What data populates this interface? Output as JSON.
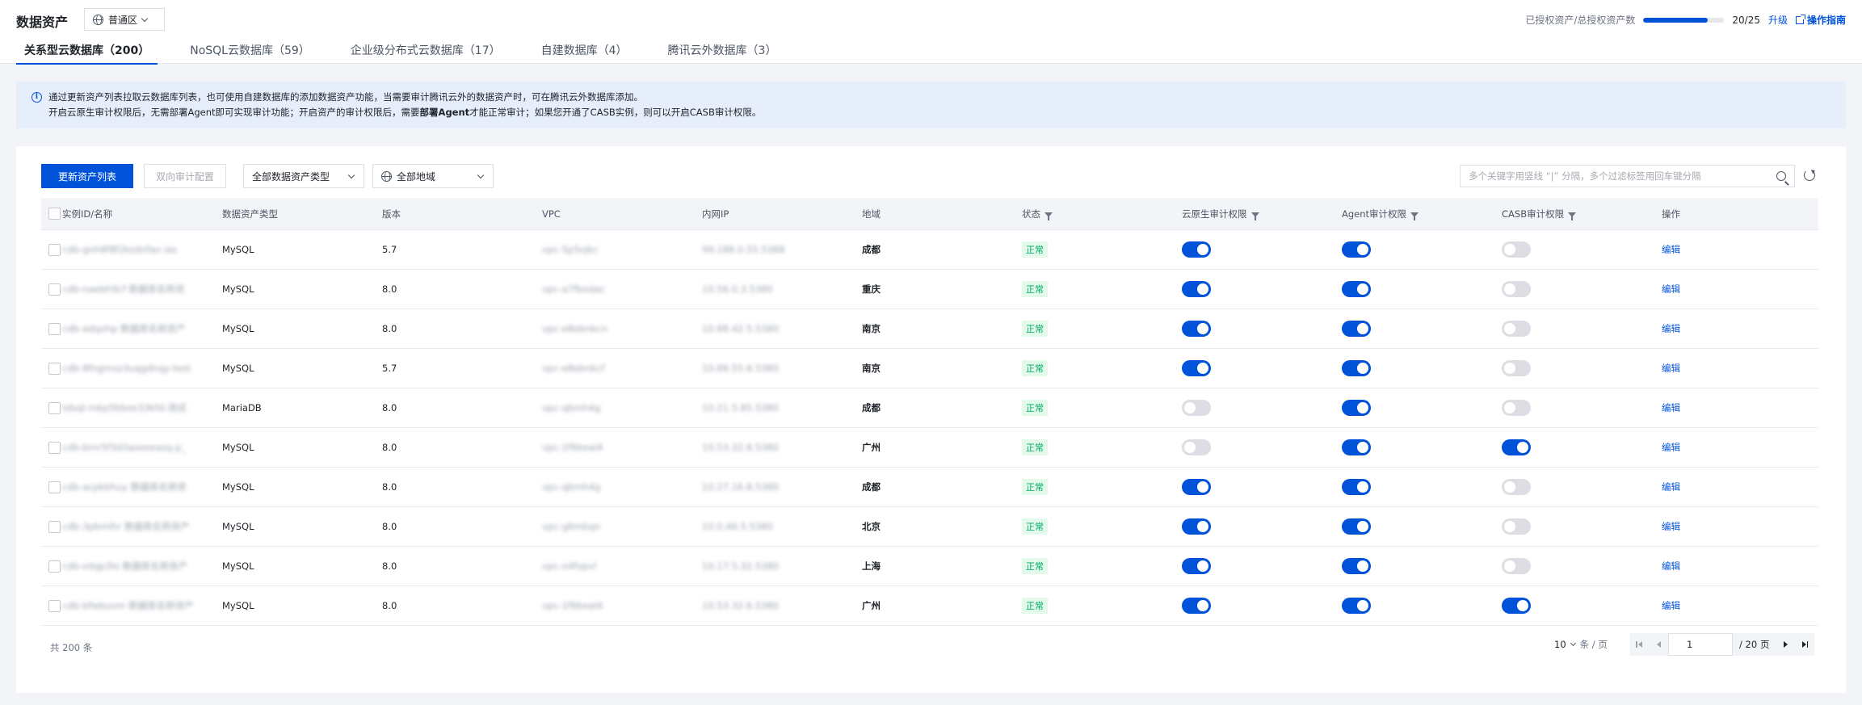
{
  "header": {
    "title": "数据资产",
    "region": "普通区",
    "quota_label": "已授权资产/总授权资产数",
    "quota_used": 20,
    "quota_total": 25,
    "quota_text": "20/25",
    "upgrade": "升级",
    "guide": "操作指南"
  },
  "tabs": [
    {
      "label": "关系型云数据库（200）",
      "active": true
    },
    {
      "label": "NoSQL云数据库（59）",
      "active": false
    },
    {
      "label": "企业级分布式云数据库（17）",
      "active": false
    },
    {
      "label": "自建数据库（4）",
      "active": false
    },
    {
      "label": "腾讯云外数据库（3）",
      "active": false
    }
  ],
  "notice": {
    "line1": "通过更新资产列表拉取云数据库列表，也可使用自建数据库的添加数据资产功能，当需要审计腾讯云外的数据资产时，可在腾讯云外数据库添加。",
    "line2_a": "开启云原生审计权限后，无需部署Agent即可实现审计功能；开启资产的审计权限后，需要",
    "line2_b": "部署Agent",
    "line2_c": "才能正常审计；如果您开通了CASB实例，则可以开启CASB审计权限。"
  },
  "toolbar": {
    "update_button": "更新资产列表",
    "bidirectional_button": "双向审计配置",
    "asset_type_select": "全部数据资产类型",
    "region_select": "全部地域",
    "search_placeholder": "多个关键字用竖线 “|” 分隔，多个过滤标签用回车键分隔"
  },
  "table": {
    "headers": [
      "实例ID/名称",
      "数据资产类型",
      "版本",
      "VPC",
      "内网IP",
      "地域",
      "状态",
      "云原生审计权限",
      "Agent审计权限",
      "CASB审计权限",
      "操作"
    ],
    "rows": [
      {
        "id": "cdb-gnh8f8f2ksdnfao ias",
        "type": "MySQL",
        "version": "5.7",
        "vpc": "vpc-5p5ojkc",
        "ip": "99.188.0.55.5388",
        "region": "成都",
        "status": "正常",
        "cloud": true,
        "agent": true,
        "casb": false,
        "action": "编辑"
      },
      {
        "id": "cdb-naebh9cf 数据库名称资",
        "type": "MySQL",
        "version": "8.0",
        "vpc": "vpc-a7fbodac",
        "ip": "10.56.0.3.5380",
        "region": "重庆",
        "status": "正常",
        "cloud": true,
        "agent": true,
        "casb": false,
        "action": "编辑"
      },
      {
        "id": "cdb-adqohp 数据库名称资产",
        "type": "MySQL",
        "version": "8.0",
        "vpc": "vpc-e8ebnkcn",
        "ip": "10.88.42.5.5380",
        "region": "南京",
        "status": "正常",
        "cloud": true,
        "agent": true,
        "casb": false,
        "action": "编辑"
      },
      {
        "id": "cdb-8fngmoz3uqgdnqy-test",
        "type": "MySQL",
        "version": "5.7",
        "vpc": "vpc-e8ebnkcf",
        "ip": "10.88.55.8.5380",
        "region": "南京",
        "status": "正常",
        "cloud": true,
        "agent": true,
        "casb": false,
        "action": "编辑"
      },
      {
        "id": "tdsql-mkp5bboe33kfd-测试",
        "type": "MariaDB",
        "version": "8.0",
        "vpc": "vpc-qbmh4g",
        "ip": "10.21.5.85.5380",
        "region": "成都",
        "status": "正常",
        "cloud": false,
        "agent": true,
        "casb": false,
        "action": "编辑"
      },
      {
        "id": "cdb-bmr5f3d3aseeeasq-p_",
        "type": "MySQL",
        "version": "8.0",
        "vpc": "vpc-1f6beal4",
        "ip": "10.53.32.8.5380",
        "region": "广州",
        "status": "正常",
        "cloud": false,
        "agent": true,
        "casb": true,
        "action": "编辑"
      },
      {
        "id": "cdb-acpkbhuy 数据库名称资",
        "type": "MySQL",
        "version": "8.0",
        "vpc": "vpc-qbmh4g",
        "ip": "10.27.16.8.5380",
        "region": "成都",
        "status": "正常",
        "cloud": true,
        "agent": true,
        "casb": false,
        "action": "编辑"
      },
      {
        "id": "cdb-3pbmlhr 数据库名称资产",
        "type": "MySQL",
        "version": "8.0",
        "vpc": "vpc-g6mbqn",
        "ip": "10.0.46.5.5380",
        "region": "北京",
        "status": "正常",
        "cloud": true,
        "agent": true,
        "casb": false,
        "action": "编辑"
      },
      {
        "id": "cdb-vdqp3lo 数据库名称资产",
        "type": "MySQL",
        "version": "8.0",
        "vpc": "vpc-o4fopvl",
        "ip": "10.17.5.32.5380",
        "region": "上海",
        "status": "正常",
        "cloud": true,
        "agent": true,
        "casb": false,
        "action": "编辑"
      },
      {
        "id": "cdb-bfwbuom 数据库名称资产",
        "type": "MySQL",
        "version": "8.0",
        "vpc": "vpc-1f6beal4",
        "ip": "10.53.32.6.5380",
        "region": "广州",
        "status": "正常",
        "cloud": true,
        "agent": true,
        "casb": true,
        "action": "编辑"
      }
    ]
  },
  "pagination": {
    "total": "共 200 条",
    "page_size": "10",
    "page_size_unit": "条 / 页",
    "current_page": "1",
    "total_pages": "/ 20 页"
  },
  "colors": {
    "primary": "#0052d9",
    "success_text": "#00a870",
    "success_bg": "#e3f9e9",
    "notice_bg": "#e6edfb"
  }
}
